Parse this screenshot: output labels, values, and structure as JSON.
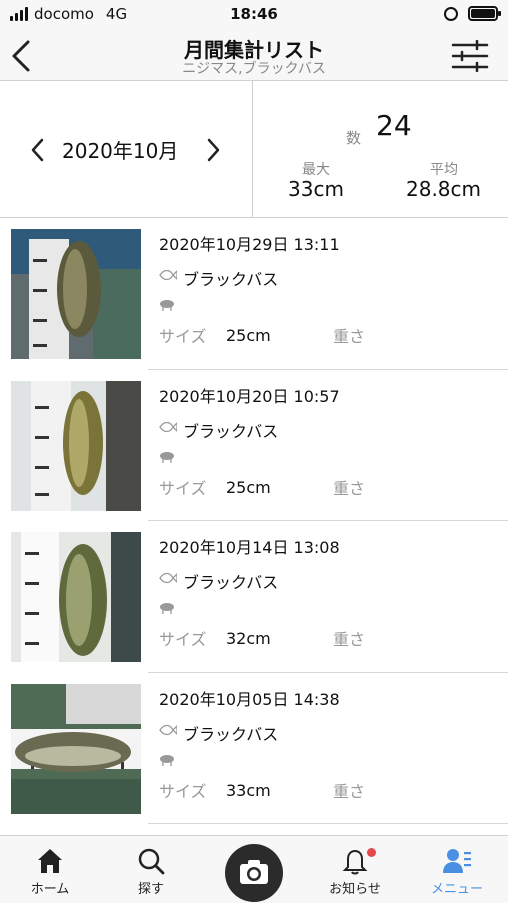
{
  "status_bar": {
    "carrier": "docomo",
    "network": "4G",
    "time": "18:46"
  },
  "header": {
    "title": "月間集計リスト",
    "subtitle": "ニジマス,ブラックバス"
  },
  "summary": {
    "month": "2020年10月",
    "count_label": "数",
    "count_value": "24",
    "max_label": "最大",
    "max_value": "33cm",
    "avg_label": "平均",
    "avg_value": "28.8cm"
  },
  "catches": [
    {
      "datetime": "2020年10月29日 13:11",
      "species": "ブラックバス",
      "size_label": "サイズ",
      "size": "25cm",
      "weight_label": "重さ"
    },
    {
      "datetime": "2020年10月20日 10:57",
      "species": "ブラックバス",
      "size_label": "サイズ",
      "size": "25cm",
      "weight_label": "重さ"
    },
    {
      "datetime": "2020年10月14日 13:08",
      "species": "ブラックバス",
      "size_label": "サイズ",
      "size": "32cm",
      "weight_label": "重さ"
    },
    {
      "datetime": "2020年10月05日 14:38",
      "species": "ブラックバス",
      "size_label": "サイズ",
      "size": "33cm",
      "weight_label": "重さ"
    }
  ],
  "tabs": [
    {
      "label": "ホーム",
      "icon": "home-icon"
    },
    {
      "label": "探す",
      "icon": "search-icon"
    },
    {
      "label": "",
      "icon": "camera-icon"
    },
    {
      "label": "お知らせ",
      "icon": "bell-icon"
    },
    {
      "label": "メニュー",
      "icon": "menu-user-icon"
    }
  ],
  "colors": {
    "accent": "#4a90e2",
    "badge": "#e5484d",
    "muted": "#888888"
  }
}
